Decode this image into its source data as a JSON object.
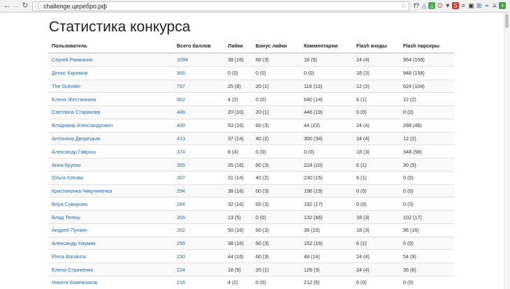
{
  "browser": {
    "url": "challenge.церебро.рф",
    "back": "←",
    "forward": "→",
    "reload": "↻",
    "info": "ⓘ",
    "star": "☆",
    "extensions": [
      {
        "icon": "font-icon",
        "glyph": "f?",
        "color": "#333333",
        "bg": "transparent"
      },
      {
        "icon": "drive-icon",
        "glyph": "◬",
        "color": "#3a7bd5",
        "bg": "transparent"
      },
      {
        "icon": "download-icon",
        "glyph": "↓",
        "color": "#ffffff",
        "bg": "#4caf50"
      },
      {
        "icon": "opera-icon",
        "glyph": "O",
        "color": "#d32f2f",
        "bg": "transparent"
      },
      {
        "icon": "ublock-icon",
        "glyph": "▼",
        "color": "#555555",
        "bg": "transparent"
      },
      {
        "icon": "s-icon",
        "glyph": "S",
        "color": "#ffffff",
        "bg": "#d32f2f"
      },
      {
        "icon": "list-icon",
        "glyph": "≡",
        "color": "#555555",
        "bg": "transparent"
      },
      {
        "icon": "window-icon",
        "glyph": "▣",
        "color": "#333333",
        "bg": "transparent"
      },
      {
        "icon": "grid-icon",
        "glyph": "⊞",
        "color": "#1565c0",
        "bg": "transparent"
      },
      {
        "icon": "tool-icon",
        "glyph": "⌁",
        "color": "#333333",
        "bg": "transparent"
      },
      {
        "icon": "lang-icon",
        "glyph": "⚔",
        "color": "#333333",
        "bg": "transparent"
      },
      {
        "icon": "plus-icon",
        "glyph": "+",
        "color": "#ffffff",
        "bg": "#43a047"
      }
    ]
  },
  "page": {
    "title": "Статистика конкурса",
    "columns": [
      "Пользователь",
      "Всего баллов",
      "Лайки",
      "Бонус лайки",
      "Комментарии",
      "Flash входы",
      "Flash парсеры"
    ],
    "rows": [
      [
        "Сергей Рахманин",
        "1094",
        "38 (16)",
        "60 (3)",
        "18 (5)",
        "24 (4)",
        "954 (159)"
      ],
      [
        "Денис Каримов",
        "966",
        "0 (0)",
        "0 (0)",
        "0 (0)",
        "18 (3)",
        "948 (158)"
      ],
      [
        "The Outsider",
        "797",
        "25 (8)",
        "20 (1)",
        "116 (13)",
        "12 (2)",
        "624 (104)"
      ],
      [
        "Елена Жестянкина",
        "662",
        "4 (2)",
        "0 (0)",
        "640 (14)",
        "6 (1)",
        "12 (2)"
      ],
      [
        "Светлана Старикова",
        "486",
        "20 (10)",
        "20 (1)",
        "446 (19)",
        "0 (0)",
        "0 (0)"
      ],
      [
        "Владимир Александрович",
        "469",
        "53 (16)",
        "60 (3)",
        "44 (22)",
        "24 (4)",
        "288 (48)"
      ],
      [
        "Антонина Дворецкая",
        "413",
        "37 (14)",
        "40 (2)",
        "300 (34)",
        "24 (4)",
        "12 (2)"
      ],
      [
        "Александр Гавриш",
        "374",
        "8 (4)",
        "0 (0)",
        "0 (0)",
        "18 (3)",
        "348 (58)"
      ],
      [
        "Анна Крупко",
        "355",
        "35 (16)",
        "60 (3)",
        "224 (10)",
        "6 (1)",
        "30 (5)"
      ],
      [
        "Ольга Котова",
        "307",
        "31 (14)",
        "40 (2)",
        "230 (15)",
        "6 (1)",
        "0 (0)"
      ],
      [
        "Кристиночка Чикучиночка",
        "294",
        "38 (16)",
        "60 (3)",
        "196 (19)",
        "0 (0)",
        "0 (0)"
      ],
      [
        "Вера Суворова",
        "284",
        "32 (16)",
        "60 (3)",
        "192 (17)",
        "0 (0)",
        "0 (0)"
      ],
      [
        "Влад Тепеш",
        "265",
        "13 (5)",
        "0 (0)",
        "132 (66)",
        "18 (3)",
        "102 (17)"
      ],
      [
        "Андрей Пупкин",
        "262",
        "50 (16)",
        "60 (3)",
        "38 (15)",
        "18 (3)",
        "96 (16)"
      ],
      [
        "Александр Наумик",
        "256",
        "38 (16)",
        "60 (3)",
        "152 (16)",
        "6 (1)",
        "0 (0)"
      ],
      [
        "Elena Barakina",
        "230",
        "44 (16)",
        "60 (3)",
        "48 (14)",
        "24 (4)",
        "54 (9)"
      ],
      [
        "Елена Стриженко",
        "224",
        "18 (9)",
        "20 (1)",
        "126 (3)",
        "24 (4)",
        "36 (6)"
      ],
      [
        "Никита Кожевников",
        "216",
        "4 (2)",
        "0 (0)",
        "212 (6)",
        "0 (0)",
        "0 (0)"
      ]
    ]
  }
}
